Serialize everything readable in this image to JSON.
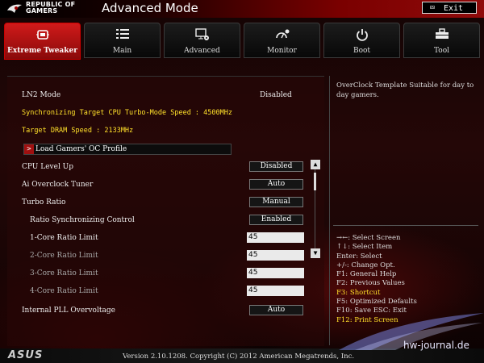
{
  "header": {
    "brand_line1": "REPUBLIC OF",
    "brand_line2": "GAMERS",
    "title": "Advanced Mode",
    "exit_label": "Exit"
  },
  "tabs": [
    {
      "label": "Extreme Tweaker",
      "icon": "tweaker-icon",
      "active": true
    },
    {
      "label": "Main",
      "icon": "list-icon",
      "active": false
    },
    {
      "label": "Advanced",
      "icon": "monitor-gear-icon",
      "active": false
    },
    {
      "label": "Monitor",
      "icon": "gauge-gear-icon",
      "active": false
    },
    {
      "label": "Boot",
      "icon": "power-icon",
      "active": false
    },
    {
      "label": "Tool",
      "icon": "toolbox-icon",
      "active": false
    }
  ],
  "main": {
    "lm2_label": "LN2 Mode",
    "lm2_value": "Disabled",
    "sync_info": "Synchronizing Target CPU Turbo-Mode Speed : 4500MHz",
    "dram_info": "Target DRAM Speed : 2133MHz",
    "load_profile": "Load Gamers' OC Profile",
    "settings": [
      {
        "label": "CPU Level Up",
        "value": "Disabled"
      },
      {
        "label": "Ai Overclock Tuner",
        "value": "Auto"
      },
      {
        "label": "Turbo Ratio",
        "value": "Manual"
      },
      {
        "label": "Ratio Synchronizing Control",
        "value": "Enabled"
      },
      {
        "label": "1-Core Ratio Limit",
        "value": "45"
      },
      {
        "label": "2-Core Ratio Limit",
        "value": "45"
      },
      {
        "label": "3-Core Ratio Limit",
        "value": "45"
      },
      {
        "label": "4-Core Ratio Limit",
        "value": "45"
      },
      {
        "label": "Internal PLL Overvoltage",
        "value": "Auto"
      }
    ]
  },
  "help": {
    "text": "OverClock Template Suitable for day to day gamers."
  },
  "keys": [
    {
      "text": "→←: Select Screen",
      "highlight": false
    },
    {
      "text": "↑↓: Select Item",
      "highlight": false
    },
    {
      "text": "Enter: Select",
      "highlight": false
    },
    {
      "text": "+/-: Change Opt.",
      "highlight": false
    },
    {
      "text": "F1: General Help",
      "highlight": false
    },
    {
      "text": "F2: Previous Values",
      "highlight": false
    },
    {
      "text": "F3: Shortcut",
      "highlight": true
    },
    {
      "text": "F5: Optimized Defaults",
      "highlight": false
    },
    {
      "text": "F10: Save  ESC: Exit",
      "highlight": false
    },
    {
      "text": "F12: Print Screen",
      "highlight": true
    }
  ],
  "footer": {
    "asus": "ASUS",
    "version": "Version 2.10.1208. Copyright (C) 2012 American Megatrends, Inc.",
    "watermark": "hw-journal.de"
  },
  "colors": {
    "accent_red": "#c00000",
    "highlight_yellow": "#ffe02a"
  }
}
